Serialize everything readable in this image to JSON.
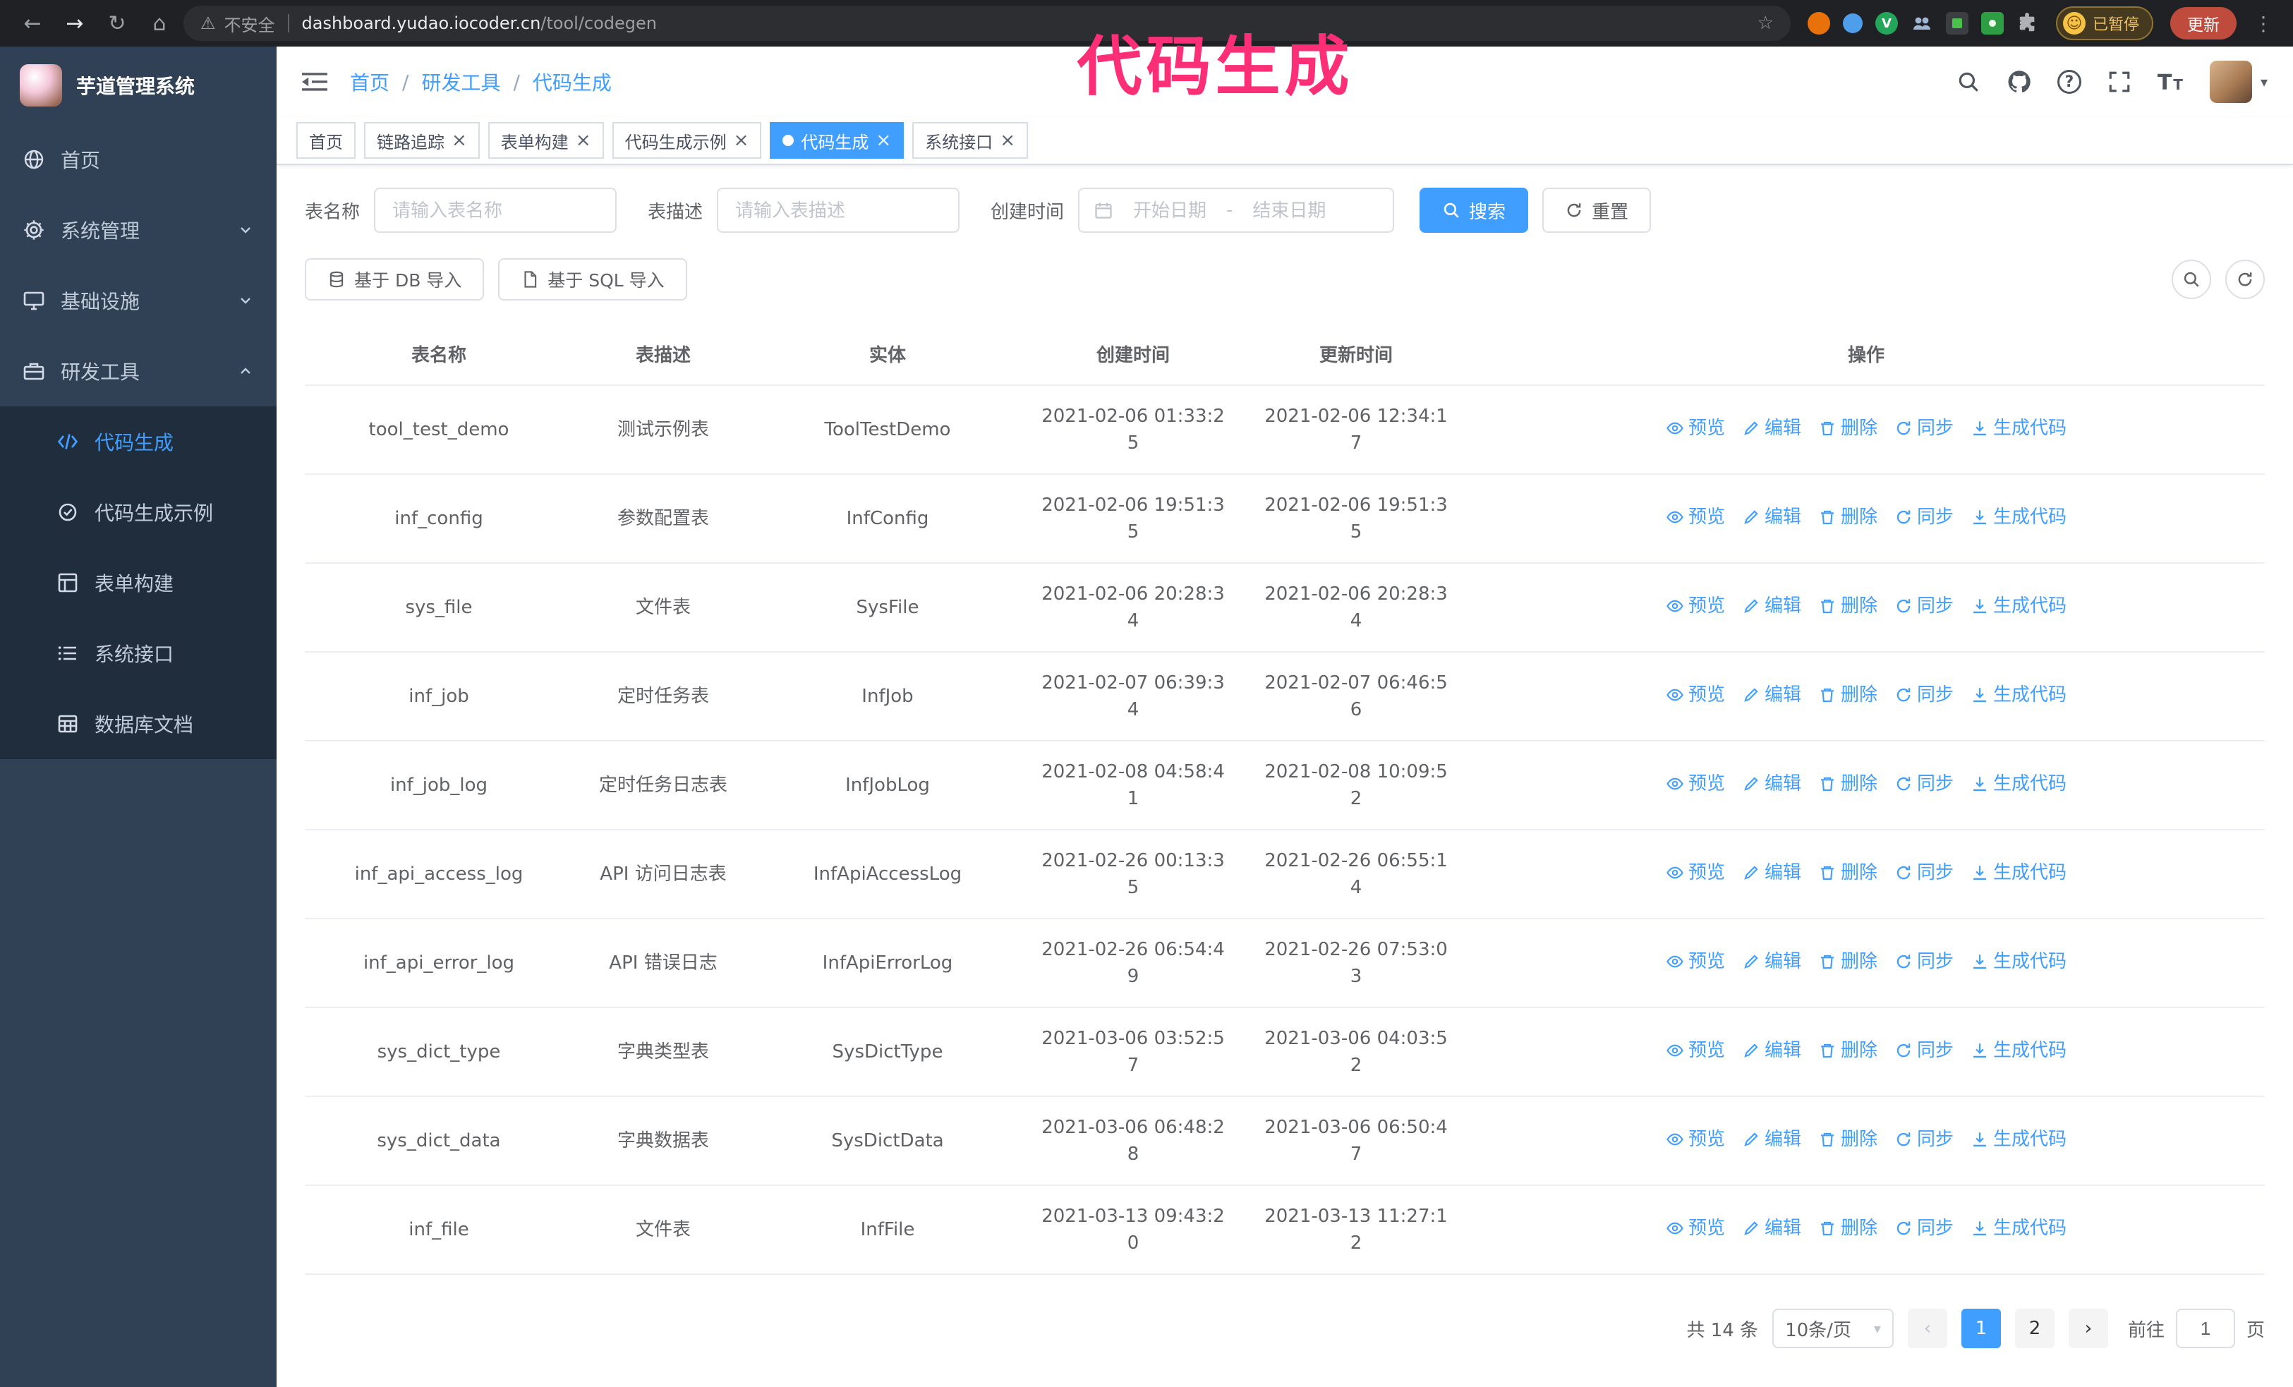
{
  "browser": {
    "security_label": "不安全",
    "url_host": "dashboard.yudao.iocoder.cn",
    "url_path": "/tool/codegen",
    "paused_badge": "已暂停",
    "update_button": "更新"
  },
  "glyphs": {
    "back": "←",
    "forward": "→",
    "reload": "↻",
    "home": "⌂",
    "warning": "⚠",
    "star": "☆",
    "menu_kebab": "⋮",
    "profile_emoji": "☺",
    "caret_down": "▾",
    "page_prev": "‹",
    "page_next": "›",
    "tab_close": "×",
    "ext_badge_letter": "V",
    "question_mark": "?"
  },
  "annotation": {
    "text": "代码生成"
  },
  "colors": {
    "accent": "#409eff",
    "sidebar_bg": "#304156",
    "submenu_bg": "#1f2d3d",
    "annotation_pink": "#fb2e76"
  },
  "sidebar": {
    "logo_title": "芋道管理系统",
    "items": [
      {
        "label": "首页"
      },
      {
        "label": "系统管理"
      },
      {
        "label": "基础设施"
      },
      {
        "label": "研发工具"
      }
    ],
    "subitems": [
      {
        "label": "代码生成"
      },
      {
        "label": "代码生成示例"
      },
      {
        "label": "表单构建"
      },
      {
        "label": "系统接口"
      },
      {
        "label": "数据库文档"
      }
    ]
  },
  "breadcrumb": [
    "首页",
    "研发工具",
    "代码生成"
  ],
  "tabs": [
    {
      "label": "首页"
    },
    {
      "label": "链路追踪"
    },
    {
      "label": "表单构建"
    },
    {
      "label": "代码生成示例"
    },
    {
      "label": "代码生成"
    },
    {
      "label": "系统接口"
    }
  ],
  "filters": {
    "table_name_label": "表名称",
    "table_name_placeholder": "请输入表名称",
    "table_desc_label": "表描述",
    "table_desc_placeholder": "请输入表描述",
    "create_time_label": "创建时间",
    "date_start_placeholder": "开始日期",
    "date_range_separator": "-",
    "date_end_placeholder": "结束日期",
    "search_button": "搜索",
    "reset_button": "重置"
  },
  "toolbar": {
    "import_db_button": "基于 DB 导入",
    "import_sql_button": "基于 SQL 导入"
  },
  "table": {
    "columns": [
      "表名称",
      "表描述",
      "实体",
      "创建时间",
      "更新时间",
      "操作"
    ],
    "actions": [
      "预览",
      "编辑",
      "删除",
      "同步",
      "生成代码"
    ],
    "rows": [
      {
        "name": "tool_test_demo",
        "desc": "测试示例表",
        "entity": "ToolTestDemo",
        "created": "2021-02-06 01:33:25",
        "updated": "2021-02-06 12:34:17"
      },
      {
        "name": "inf_config",
        "desc": "参数配置表",
        "entity": "InfConfig",
        "created": "2021-02-06 19:51:35",
        "updated": "2021-02-06 19:51:35"
      },
      {
        "name": "sys_file",
        "desc": "文件表",
        "entity": "SysFile",
        "created": "2021-02-06 20:28:34",
        "updated": "2021-02-06 20:28:34"
      },
      {
        "name": "inf_job",
        "desc": "定时任务表",
        "entity": "InfJob",
        "created": "2021-02-07 06:39:34",
        "updated": "2021-02-07 06:46:56"
      },
      {
        "name": "inf_job_log",
        "desc": "定时任务日志表",
        "entity": "InfJobLog",
        "created": "2021-02-08 04:58:41",
        "updated": "2021-02-08 10:09:52"
      },
      {
        "name": "inf_api_access_log",
        "desc": "API 访问日志表",
        "entity": "InfApiAccessLog",
        "created": "2021-02-26 00:13:35",
        "updated": "2021-02-26 06:55:14"
      },
      {
        "name": "inf_api_error_log",
        "desc": "API 错误日志",
        "entity": "InfApiErrorLog",
        "created": "2021-02-26 06:54:49",
        "updated": "2021-02-26 07:53:03"
      },
      {
        "name": "sys_dict_type",
        "desc": "字典类型表",
        "entity": "SysDictType",
        "created": "2021-03-06 03:52:57",
        "updated": "2021-03-06 04:03:52"
      },
      {
        "name": "sys_dict_data",
        "desc": "字典数据表",
        "entity": "SysDictData",
        "created": "2021-03-06 06:48:28",
        "updated": "2021-03-06 06:50:47"
      },
      {
        "name": "inf_file",
        "desc": "文件表",
        "entity": "InfFile",
        "created": "2021-03-13 09:43:20",
        "updated": "2021-03-13 11:27:12"
      }
    ]
  },
  "pagination": {
    "total_text": "共 14 条",
    "page_size_text": "10条/页",
    "pages": [
      "1",
      "2"
    ],
    "active_page": "1",
    "goto_prefix": "前往",
    "goto_value": "1",
    "goto_suffix": "页"
  }
}
